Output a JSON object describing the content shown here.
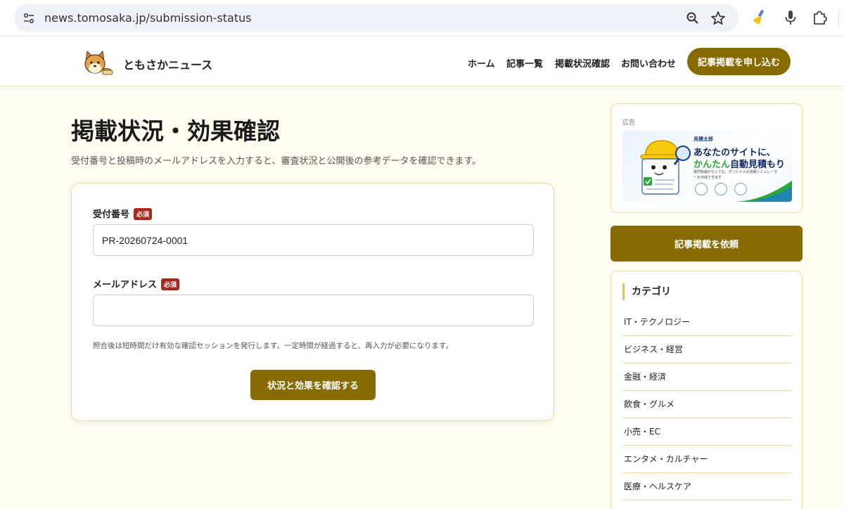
{
  "browser": {
    "url": "news.tomosaka.jp/submission-status"
  },
  "header": {
    "brand": "ともさかニュース",
    "nav": [
      "ホーム",
      "記事一覧",
      "掲載状況確認",
      "お問い合わせ"
    ],
    "cta_label": "記事掲載を申し込む"
  },
  "main": {
    "title": "掲載状況・効果確認",
    "description": "受付番号と投稿時のメールアドレスを入力すると、審査状況と公開後の参考データを確認できます。",
    "form": {
      "receipt_label": "受付番号",
      "required_badge": "必須",
      "receipt_value": "PR-20260724-0001",
      "email_label": "メールアドレス",
      "email_value": "",
      "help_text": "照合後は短時間だけ有効な確認セッションを発行します。一定時間が経過すると、再入力が必要になります。",
      "submit_label": "状況と効果を確認する"
    }
  },
  "sidebar": {
    "ad_label": "広告",
    "ad": {
      "brand": "見積太郎",
      "headline1": "あなたのサイトに、",
      "headline2_highlight": "かんたん",
      "headline2_rest": "自動見積もり",
      "sub": "専門知識がなくても、オリジナルの見積シミュレーターを作成できます"
    },
    "cta_label": "記事掲載を依頼",
    "categories_title": "カテゴリ",
    "categories": [
      "IT・テクノロジー",
      "ビジネス・経営",
      "金融・経済",
      "飲食・グルメ",
      "小売・EC",
      "エンタメ・カルチャー",
      "医療・ヘルスケア"
    ]
  },
  "colors": {
    "accent": "#876b00",
    "page_bg": "#fffdf0",
    "card_border": "#f0dc9a",
    "badge": "#a82a1d"
  }
}
